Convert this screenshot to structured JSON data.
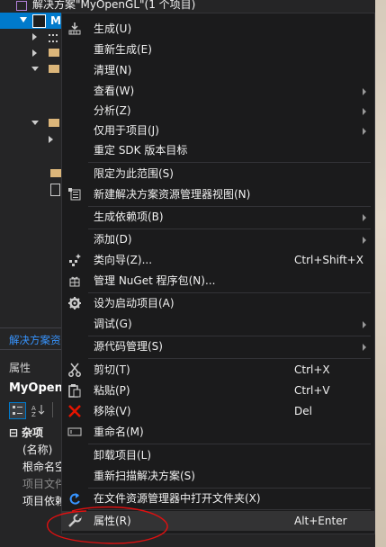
{
  "solution": {
    "title": "解决方案\"MyOpenGL\"(1 个项目)",
    "project": "MyOpenGL"
  },
  "panel": {
    "explorer_tab": "解决方案资",
    "properties_title": "属性",
    "object_name": "MyOpenGL",
    "category": "杂项",
    "rows": [
      "(名称)",
      "根命名空间",
      "项目文件",
      "项目依赖"
    ]
  },
  "menu": {
    "items": [
      {
        "label": "生成(U)",
        "icon": "build-icon"
      },
      {
        "label": "重新生成(E)"
      },
      {
        "label": "清理(N)"
      },
      {
        "label": "查看(W)",
        "submenu": true
      },
      {
        "label": "分析(Z)",
        "submenu": true
      },
      {
        "label": "仅用于项目(J)",
        "submenu": true
      },
      {
        "label": "重定 SDK 版本目标"
      },
      {
        "label": "限定为此范围(S)"
      },
      {
        "label": "新建解决方案资源管理器视图(N)",
        "icon": "new-view-icon"
      },
      {
        "label": "生成依赖项(B)",
        "submenu": true
      },
      {
        "label": "添加(D)",
        "submenu": true
      },
      {
        "label": "类向导(Z)...",
        "shortcut": "Ctrl+Shift+X",
        "icon": "class-wizard-icon"
      },
      {
        "label": "管理 NuGet 程序包(N)...",
        "icon": "nuget-icon"
      },
      {
        "label": "设为启动项目(A)",
        "icon": "gear-icon"
      },
      {
        "label": "调试(G)",
        "submenu": true
      },
      {
        "label": "源代码管理(S)",
        "submenu": true
      },
      {
        "label": "剪切(T)",
        "shortcut": "Ctrl+X",
        "icon": "scissors-icon"
      },
      {
        "label": "粘贴(P)",
        "shortcut": "Ctrl+V",
        "icon": "paste-icon"
      },
      {
        "label": "移除(V)",
        "shortcut": "Del",
        "icon": "remove-icon"
      },
      {
        "label": "重命名(M)",
        "icon": "rename-icon"
      },
      {
        "label": "卸载项目(L)"
      },
      {
        "label": "重新扫描解决方案(S)"
      },
      {
        "label": "在文件资源管理器中打开文件夹(X)",
        "icon": "open-folder-icon"
      },
      {
        "label": "属性(R)",
        "shortcut": "Alt+Enter",
        "icon": "wrench-icon"
      }
    ]
  },
  "colors": {
    "menu_bg": "#1b1b1c",
    "selection": "#007acc",
    "annotation": "#e01010",
    "remove_icon": "#e51400"
  }
}
